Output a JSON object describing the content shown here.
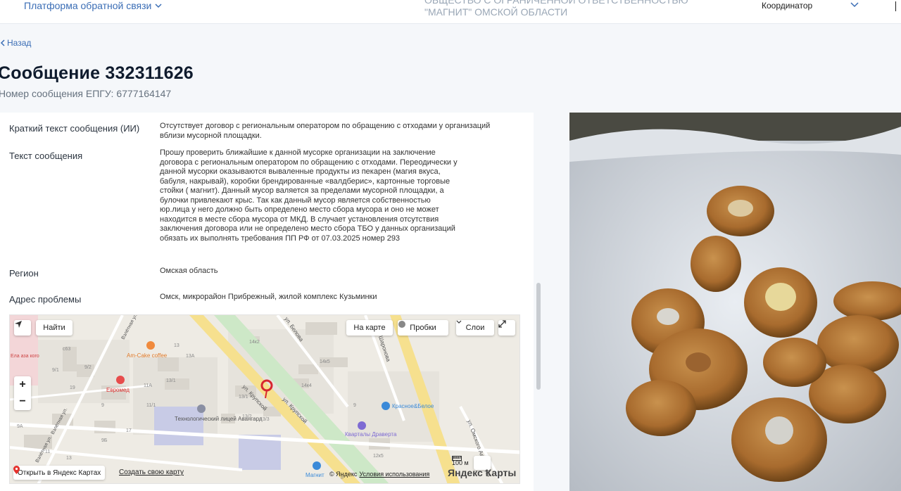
{
  "header": {
    "platform_link": "Платформа обратной связи",
    "org_name_line1": "ОБЩЕСТВО С ОГРАНИЧЕННОЙ ОТВЕТСТВЕННОСТЬЮ",
    "org_name_line2": "\"МАГНИТ\" ОМСКОЙ ОБЛАСТИ",
    "user_role": "Координатор"
  },
  "back_label": "Назад",
  "page_title": "Сообщение 332311626",
  "epgu": {
    "label": "Номер сообщения ЕПГУ:",
    "value": "6777164147"
  },
  "fields": [
    {
      "label": "Краткий текст сообщения (ИИ)",
      "value": "Отсутствует договор с региональным оператором по обращению с отходами у организаций вблизи мусорной площадки."
    },
    {
      "label": "Текст сообщения",
      "value": "Прошу проверить ближайшие к данной мусорке организации на заключение договора с региональным оператором по обращению с отходами. Переодически у данной мусорки оказываются вываленные продукты из пекарен (магия вкуса, бабуля, накрывай), коробки брендированные «валдберис», картонные торговые стойки ( магнит). Данный мусор валяется за пределами мусорной площадки, а булочки привлекают крыс. Так как данный мусор является собственностью юр.лица у него должно быть определено место сбора мусора и оно не может находится в месте сбора мусора от МКД. В случает установления отсутствия заключения договора или не определено место сбора ТБО у данных организаций обязать их выполнять требования ПП РФ от 07.03.2025 номер 293"
    },
    {
      "label": "Регион",
      "value": "Омская область"
    },
    {
      "label": "Адрес проблемы",
      "value": "Омск, микрорайон Прибрежный, жилой комплекс Кузьминки"
    }
  ],
  "map": {
    "find_button": "Найти",
    "on_map_button": "На карте",
    "traffic_button": "Пробки",
    "layers_button": "Слои",
    "open_in_yandex": "Открыть в Яндекс Картах",
    "create_map": "Создать свою карту",
    "copyright": "© Яндекс",
    "terms": "Условия использования",
    "logo": "Яндекс Карты",
    "scale": "100 м",
    "labels": {
      "street1": "ул. Крупской",
      "street2": "ул. Крупской",
      "street3": "ул. Белова",
      "street4": "ул. Шаронова",
      "street5": "ул. Омского Авангарда",
      "street6": "Взлётная ул.",
      "street7": "Взлётная ул.",
      "street8": "Взлётная ул.",
      "poi1": "Am-Cake coffee",
      "poi2": "Евромед",
      "poi3": "Технологический лицей Авангард",
      "poi4": "Кварталы Драверта",
      "poi5": "Красное&Белое",
      "poi6": "Магнит",
      "poi7": "Ела аза кого"
    },
    "houses": [
      "с63",
      "9/1",
      "9/2",
      "13",
      "13A",
      "11A",
      "13/1",
      "13/1",
      "11/1",
      "9",
      "19",
      "9A",
      "9Б",
      "17",
      "11",
      "13",
      "14к2",
      "14к5",
      "14к4",
      "13/2",
      "13/3",
      "9",
      "12к5",
      "8"
    ]
  }
}
